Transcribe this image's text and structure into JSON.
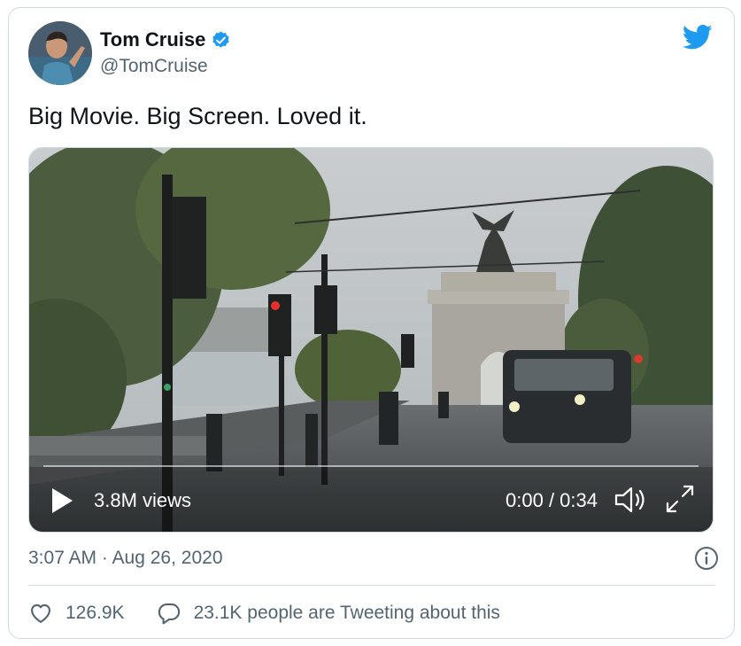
{
  "author": {
    "name": "Tom Cruise",
    "handle": "@TomCruise",
    "verified": true
  },
  "tweet": {
    "text": "Big Movie. Big Screen. Loved it.",
    "timestamp": "3:07 AM · Aug 26, 2020"
  },
  "video": {
    "views": "3.8M views",
    "time": "0:00 / 0:34",
    "progress": 0
  },
  "actions": {
    "likes": "126.9K",
    "conversation": "23.1K people are Tweeting about this"
  },
  "colors": {
    "brand": "#1d9bf0",
    "secondary_text": "#536471",
    "border": "#cfd9de"
  },
  "icons": {
    "logo": "twitter-bird-icon",
    "verified": "verified-badge-icon",
    "play": "play-icon",
    "volume": "volume-icon",
    "fullscreen": "fullscreen-icon",
    "info": "info-icon",
    "like": "heart-icon",
    "reply": "reply-bubble-icon"
  }
}
